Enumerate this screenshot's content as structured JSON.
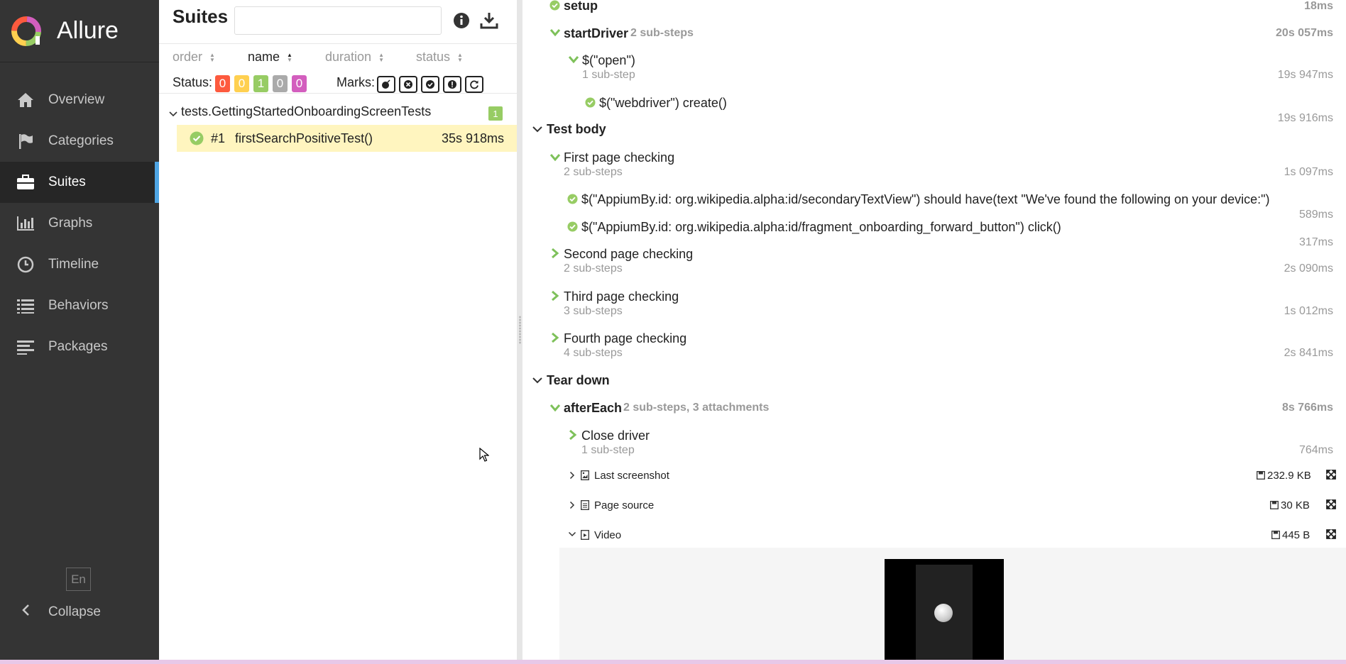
{
  "app": {
    "title": "Allure"
  },
  "sidebar": {
    "items": [
      {
        "label": "Overview",
        "icon": "home-icon"
      },
      {
        "label": "Categories",
        "icon": "flag-icon"
      },
      {
        "label": "Suites",
        "icon": "briefcase-icon",
        "active": true
      },
      {
        "label": "Graphs",
        "icon": "bar-chart-icon"
      },
      {
        "label": "Timeline",
        "icon": "clock-icon"
      },
      {
        "label": "Behaviors",
        "icon": "list-icon"
      },
      {
        "label": "Packages",
        "icon": "align-left-icon"
      }
    ],
    "lang": "En",
    "collapse": "Collapse"
  },
  "tree": {
    "title": "Suites",
    "search_value": "",
    "sort": {
      "order": "order",
      "name": "name",
      "duration": "duration",
      "status": "status"
    },
    "status_label": "Status:",
    "status_counts": [
      {
        "value": "0",
        "color": "#fd5a3e"
      },
      {
        "value": "0",
        "color": "#ffd050"
      },
      {
        "value": "1",
        "color": "#97cc64"
      },
      {
        "value": "0",
        "color": "#aaaaaa"
      },
      {
        "value": "0",
        "color": "#d35ebe"
      }
    ],
    "marks_label": "Marks:",
    "group": {
      "name": "tests.GettingStartedOnboardingScreenTests",
      "count": "1"
    },
    "testcase": {
      "num": "#1",
      "name": "firstSearchPositiveTest()",
      "duration": "35s 918ms"
    }
  },
  "main": {
    "setup": {
      "label": "setup",
      "time": "18ms"
    },
    "startDriver": {
      "label": "startDriver",
      "sub": "2 sub-steps",
      "time": "20s 057ms"
    },
    "open": {
      "label": "$(\"open\")",
      "sub": "1 sub-step",
      "time": "19s 947ms"
    },
    "webdriver": {
      "label": "$(\"webdriver\") create()",
      "time": "19s 916ms"
    },
    "test_body": "Test body",
    "first_page": {
      "label": "First page checking",
      "sub": "2 sub-steps",
      "time": "1s 097ms"
    },
    "secondary": {
      "label": "$(\"AppiumBy.id: org.wikipedia.alpha:id/secondaryTextView\") should have(text \"We've found the following on your device:\")",
      "time": "589ms"
    },
    "forward": {
      "label": "$(\"AppiumBy.id: org.wikipedia.alpha:id/fragment_onboarding_forward_button\") click()",
      "time": "317ms"
    },
    "second_page": {
      "label": "Second page checking",
      "sub": "2 sub-steps",
      "time": "2s 090ms"
    },
    "third_page": {
      "label": "Third page checking",
      "sub": "3 sub-steps",
      "time": "1s 012ms"
    },
    "fourth_page": {
      "label": "Fourth page checking",
      "sub": "4 sub-steps",
      "time": "2s 841ms"
    },
    "tear_down": "Tear down",
    "afterEach": {
      "label": "afterEach",
      "sub": "2 sub-steps, 3 attachments",
      "time": "8s 766ms"
    },
    "close_driver": {
      "label": "Close driver",
      "sub": "1 sub-step",
      "time": "764ms"
    },
    "attachments": [
      {
        "label": "Last screenshot",
        "size": "232.9 KB"
      },
      {
        "label": "Page source",
        "size": "30 KB"
      },
      {
        "label": "Video",
        "size": "445 B"
      }
    ]
  },
  "colors": {
    "sidebar": "#343434",
    "passed": "#97cc64",
    "selected": "#fff5bf",
    "accent": "#4fa5e4"
  }
}
